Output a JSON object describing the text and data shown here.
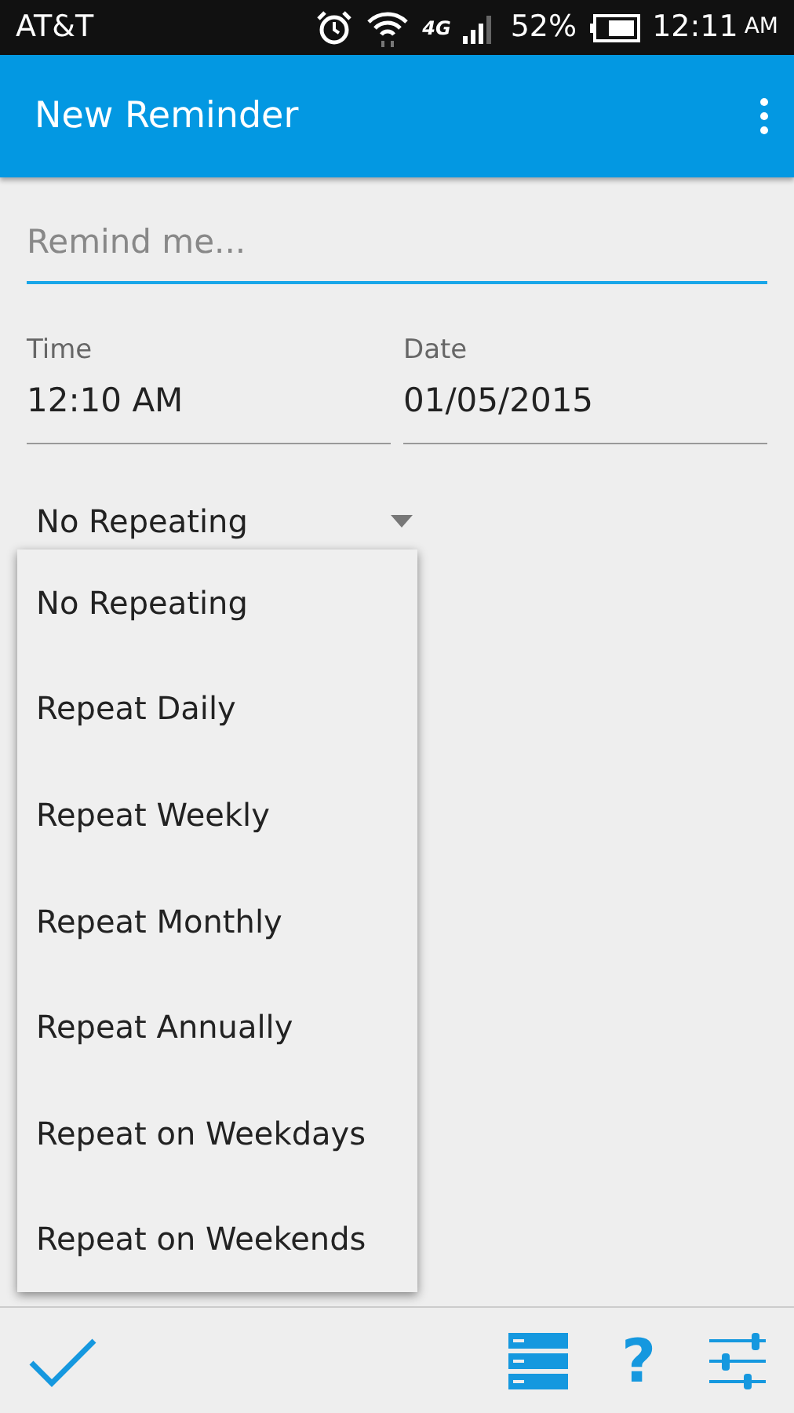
{
  "status_bar": {
    "carrier": "AT&T",
    "network": "4G",
    "battery": "52%",
    "clock": "12:11",
    "ampm": "AM"
  },
  "app_bar": {
    "title": "New Reminder"
  },
  "reminder_field": {
    "placeholder": "Remind me..."
  },
  "time": {
    "label": "Time",
    "value": "12:10 AM"
  },
  "date": {
    "label": "Date",
    "value": "01/05/2015"
  },
  "repeat_spinner": {
    "value": "No Repeating",
    "expanded": true
  },
  "repeat_options": [
    {
      "label": "No Repeating"
    },
    {
      "label": "Repeat Daily"
    },
    {
      "label": "Repeat Weekly"
    },
    {
      "label": "Repeat Monthly"
    },
    {
      "label": "Repeat Annually"
    },
    {
      "label": "Repeat on Weekdays"
    },
    {
      "label": "Repeat on Weekends"
    }
  ],
  "bottom_bar": {
    "help": "?"
  }
}
